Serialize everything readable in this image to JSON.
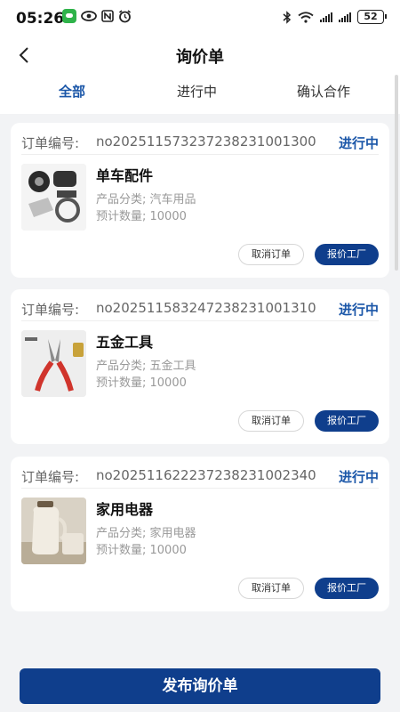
{
  "status_bar": {
    "time": "05:26",
    "battery": "52",
    "icons": [
      "wechat-icon",
      "eye-icon",
      "nfc-icon",
      "alarm-icon",
      "bluetooth-icon",
      "wifi-icon",
      "signal-icon",
      "signal-icon",
      "battery-icon"
    ]
  },
  "header": {
    "title": "询价单",
    "back_icon": "chevron-left-icon"
  },
  "tabs": [
    {
      "label": "全部",
      "active": true
    },
    {
      "label": "进行中",
      "active": false
    },
    {
      "label": "确认合作",
      "active": false
    }
  ],
  "orders": [
    {
      "order_label": "订单编号:",
      "order_no": "no20251157323723823100130​0",
      "status": "进行中",
      "product_name": "单车配件",
      "category": "产品分类; 汽车用品",
      "quantity": "预计数量; 10000",
      "cancel_label": "取消订单",
      "quote_label": "报价工厂"
    },
    {
      "order_label": "订单编号:",
      "order_no": "no20251158324723823100131​0",
      "status": "进行中",
      "product_name": "五金工具",
      "category": "产品分类; 五金工具",
      "quantity": "预计数量; 10000",
      "cancel_label": "取消订单",
      "quote_label": "报价工厂"
    },
    {
      "order_label": "订单编号:",
      "order_no": "no20251162223723823100234​0",
      "status": "进行中",
      "product_name": "家用电器",
      "category": "产品分类; 家用电器",
      "quantity": "预计数量; 10000",
      "cancel_label": "取消订单",
      "quote_label": "报价工厂"
    }
  ],
  "publish_label": "发布询价单",
  "colors": {
    "accent": "#1a56a8",
    "primary_button": "#0f3e8c",
    "background": "#f2f3f5"
  }
}
